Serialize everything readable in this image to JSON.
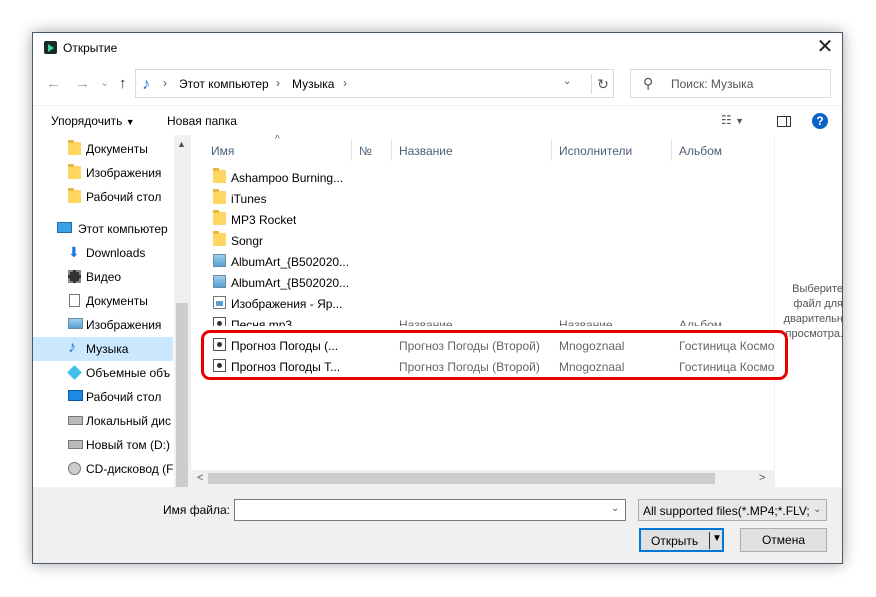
{
  "window": {
    "title": "Открытие",
    "close": "✕"
  },
  "nav": {
    "back": "←",
    "forward": "→",
    "dropdown": "⌄",
    "up": "↑",
    "breadcrumb": [
      "Этот компьютер",
      "Музыка"
    ],
    "refresh": "↻",
    "search_placeholder": "Поиск: Музыка"
  },
  "toolbar": {
    "organize": "Упорядочить",
    "new_folder": "Новая папка",
    "view_icon": "list-view-icon",
    "help": "?"
  },
  "sidebar": {
    "items": [
      {
        "label": "Документы",
        "icon": "folder-icon"
      },
      {
        "label": "Изображения",
        "icon": "folder-icon"
      },
      {
        "label": "Рабочий стол",
        "icon": "folder-icon"
      },
      {
        "label": "Этот компьютер",
        "icon": "computer-icon"
      },
      {
        "label": "Downloads",
        "icon": "download-icon"
      },
      {
        "label": "Видео",
        "icon": "video-icon"
      },
      {
        "label": "Документы",
        "icon": "document-icon"
      },
      {
        "label": "Изображения",
        "icon": "pictures-icon"
      },
      {
        "label": "Музыка",
        "icon": "music-icon",
        "selected": true
      },
      {
        "label": "Объемные объ",
        "icon": "3d-objects-icon"
      },
      {
        "label": "Рабочий стол",
        "icon": "desktop-icon"
      },
      {
        "label": "Локальный дис",
        "icon": "drive-icon"
      },
      {
        "label": "Новый том (D:)",
        "icon": "drive-icon"
      },
      {
        "label": "CD-дисковод (F",
        "icon": "cd-drive-icon"
      }
    ]
  },
  "columns": [
    "Имя",
    "№",
    "Название",
    "Исполнители",
    "Альбом"
  ],
  "files": [
    {
      "name": "Ashampoo Burning...",
      "type": "folder"
    },
    {
      "name": "iTunes",
      "type": "folder"
    },
    {
      "name": "MP3 Rocket",
      "type": "folder"
    },
    {
      "name": "Songr",
      "type": "folder"
    },
    {
      "name": "AlbumArt_{B502020...",
      "type": "image"
    },
    {
      "name": "AlbumArt_{B502020...",
      "type": "image"
    },
    {
      "name": "Изображения - Яр...",
      "type": "album"
    },
    {
      "name": "Песня.mp3",
      "type": "audio",
      "title": "Название",
      "artist": "Название",
      "album": "Альбом"
    },
    {
      "name": "Прогноз Погоды (...",
      "type": "audio",
      "title": "Прогноз Погоды (Второй)",
      "artist": "Mnogoznaal",
      "album": "Гостиница Космо"
    },
    {
      "name": "Прогноз Погоды Т...",
      "type": "audio",
      "title": "Прогноз Погоды (Второй)",
      "artist": "Mnogoznaal",
      "album": "Гостиница Космо"
    }
  ],
  "preview_text": [
    "Выберите",
    "файл для",
    "дварительн",
    "просмотра."
  ],
  "footer": {
    "filename_label": "Имя файла:",
    "filename_value": "",
    "filetype": "All supported files(*.MP4;*.FLV;",
    "open": "Открыть",
    "cancel": "Отмена"
  },
  "colors": {
    "accent": "#0078d7",
    "highlight": "#e80000",
    "selected": "#cce8ff"
  }
}
